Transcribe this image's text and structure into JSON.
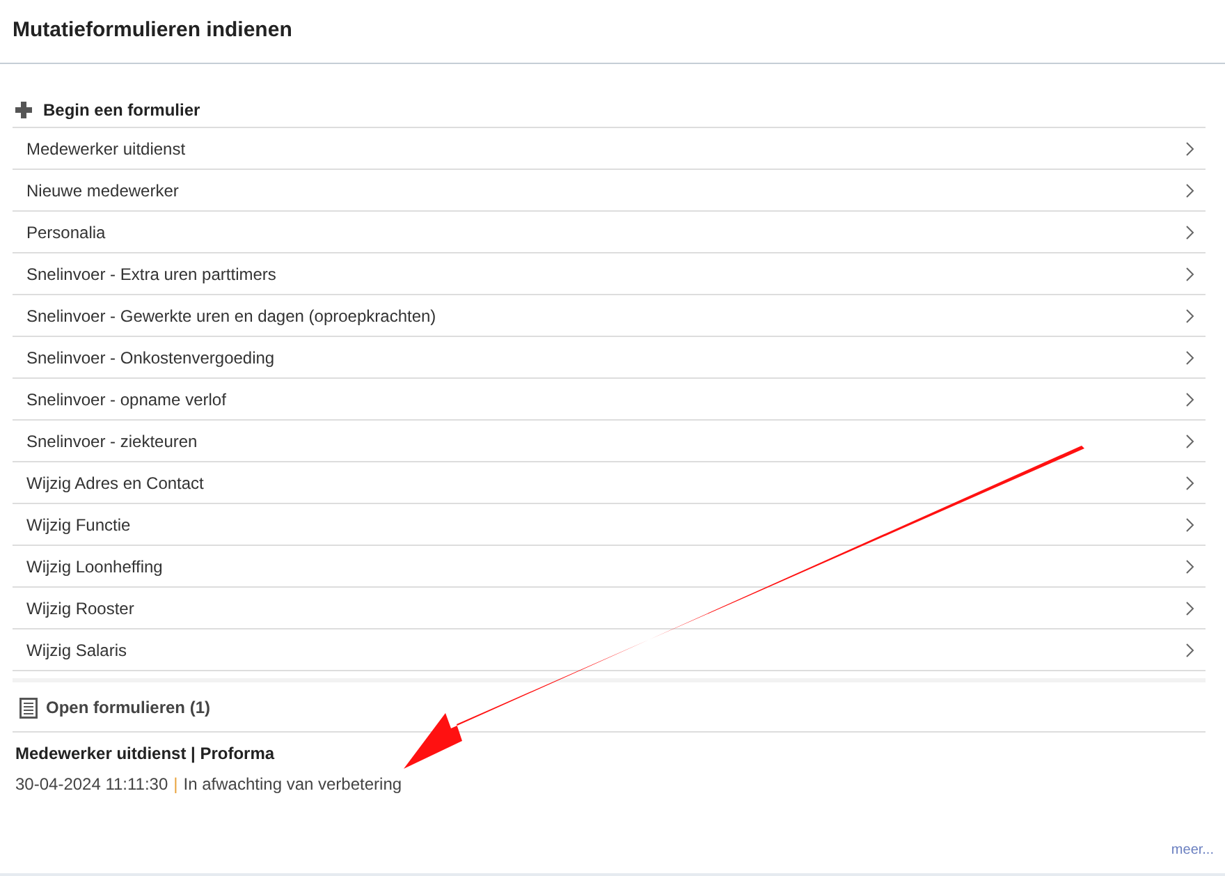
{
  "page_title": "Mutatieformulieren indienen",
  "new_form": {
    "heading": "Begin een formulier",
    "items": [
      "Medewerker uitdienst",
      "Nieuwe medewerker",
      "Personalia",
      "Snelinvoer - Extra uren parttimers",
      "Snelinvoer - Gewerkte uren en dagen (oproepkrachten)",
      "Snelinvoer - Onkostenvergoeding",
      "Snelinvoer - opname verlof",
      "Snelinvoer - ziekteuren",
      "Wijzig Adres en Contact",
      "Wijzig Functie",
      "Wijzig Loonheffing",
      "Wijzig Rooster",
      "Wijzig Salaris"
    ]
  },
  "open_forms": {
    "heading": "Open formulieren (1)",
    "items": [
      {
        "title": "Medewerker uitdienst | Proforma",
        "timestamp": "30-04-2024 11:11:30",
        "separator": "|",
        "status": "In afwachting van verbetering"
      }
    ]
  },
  "more_link": "meer..."
}
